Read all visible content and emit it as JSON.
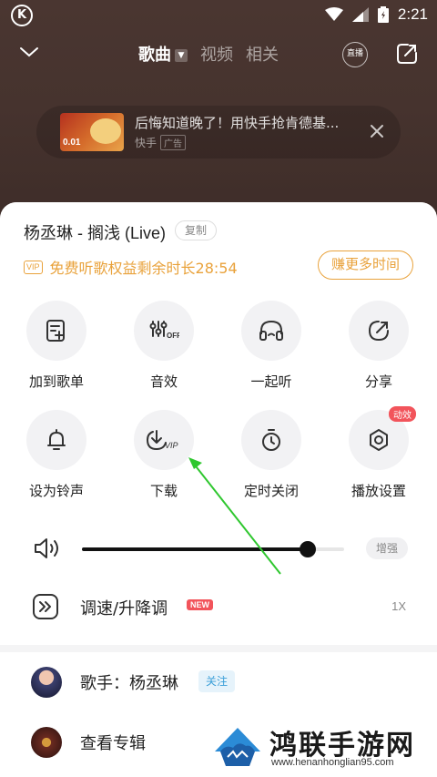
{
  "status_bar": {
    "time": "2:21"
  },
  "player_header": {
    "tabs": [
      {
        "label": "歌曲",
        "active": true
      },
      {
        "label": "视频",
        "active": false
      },
      {
        "label": "相关",
        "active": false
      }
    ],
    "live_label": "直播"
  },
  "ad": {
    "thumb_price": "0.01",
    "text": "后悔知道晚了！用快手抢肯德基...",
    "source": "快手",
    "tag": "广告"
  },
  "sheet": {
    "song_title": "杨丞琳 - 搁浅 (Live)",
    "copy_label": "复制",
    "vip_badge": "VIP",
    "vip_text": "免费听歌权益剩余时长28:54",
    "earn_button": "赚更多时间",
    "actions": [
      {
        "label": "加到歌单",
        "icon": "add-to-playlist-icon"
      },
      {
        "label": "音效",
        "icon": "sound-effects-icon"
      },
      {
        "label": "一起听",
        "icon": "listen-together-icon"
      },
      {
        "label": "分享",
        "icon": "share-icon"
      },
      {
        "label": "设为铃声",
        "icon": "bell-icon"
      },
      {
        "label": "下载",
        "icon": "vip-download-icon"
      },
      {
        "label": "定时关闭",
        "icon": "timer-icon"
      },
      {
        "label": "播放设置",
        "icon": "settings-icon",
        "badge": "动效"
      }
    ],
    "volume": {
      "level": 0.86,
      "enhance_label": "增强"
    },
    "speed": {
      "label": "调速/升降调",
      "new_badge": "NEW",
      "value": "1X"
    },
    "singer": {
      "label": "歌手：杨丞琳",
      "follow": "关注"
    },
    "album": {
      "label": "查看专辑"
    }
  },
  "watermark": {
    "title": "鸿联手游网",
    "url": "www.henanhonglian95.com"
  },
  "colors": {
    "accent_gold": "#e9a23b",
    "badge_red": "#f2545b",
    "arrow_green": "#2fc72f",
    "follow_blue": "#3a9fd8"
  }
}
